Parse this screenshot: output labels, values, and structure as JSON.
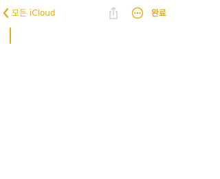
{
  "nav": {
    "back_label": "모든 iCloud",
    "back_icon": "chevron-left-icon",
    "share_icon": "share-icon",
    "more_icon": "ellipsis-circle-icon",
    "done_label": "완료"
  },
  "note": {
    "content": ""
  },
  "colors": {
    "accent": "#e0ad10",
    "disabled": "#c8c8c8",
    "background": "#ffffff"
  }
}
